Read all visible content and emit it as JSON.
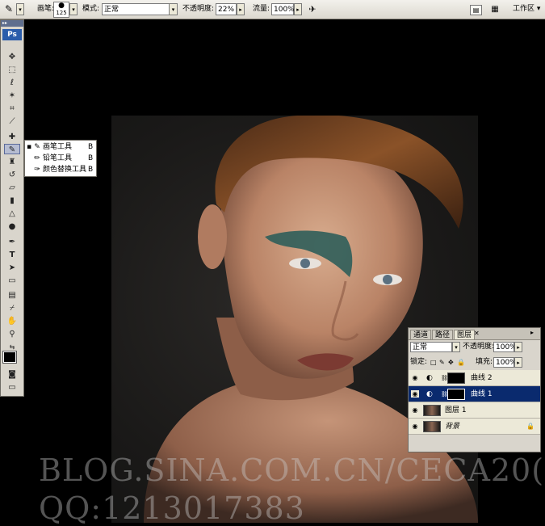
{
  "options_bar": {
    "brush_label": "画笔:",
    "brush_size": "125",
    "mode_label": "模式:",
    "mode_value": "正常",
    "opacity_label": "不透明度:",
    "opacity_value": "22%",
    "flow_label": "流量:",
    "flow_value": "100%",
    "workspace_label": "工作区"
  },
  "toolbox": {
    "logo": "Ps"
  },
  "flyout": {
    "items": [
      {
        "label": "画笔工具",
        "key": "B",
        "active": true
      },
      {
        "label": "铅笔工具",
        "key": "B",
        "active": false
      },
      {
        "label": "颜色替换工具",
        "key": "B",
        "active": false
      }
    ]
  },
  "layers_panel": {
    "tabs": [
      "通道",
      "路径",
      "图层"
    ],
    "active_tab": "图层",
    "blend_mode": "正常",
    "opacity_label": "不透明度:",
    "opacity_value": "100%",
    "lock_label": "锁定:",
    "fill_label": "填充:",
    "fill_value": "100%",
    "layers": [
      {
        "name": "曲线 2",
        "type": "curves",
        "selected": false
      },
      {
        "name": "曲线 1",
        "type": "curves",
        "selected": true
      },
      {
        "name": "图层 1",
        "type": "image",
        "selected": false
      },
      {
        "name": "背景",
        "type": "background",
        "selected": false,
        "locked": true
      }
    ]
  },
  "watermark": {
    "line1": "BLOG.SINA.COM.CN/CECA20(",
    "line2": "QQ:1213017383"
  }
}
